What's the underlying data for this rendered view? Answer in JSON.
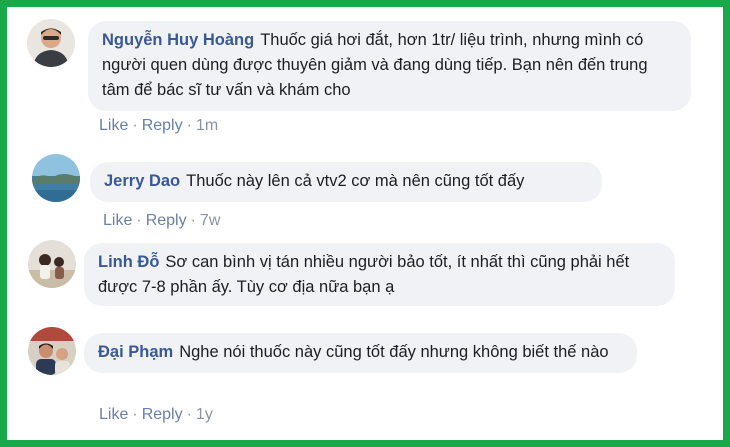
{
  "comments": [
    {
      "author": "Nguyễn Huy Hoàng",
      "text": "Thuốc giá hơi đắt, hơn 1tr/ liệu trình, nhưng mình có người quen dùng được thuyên giảm và đang dùng tiếp. Bạn nên đến trung tâm để bác sĩ tư vấn và khám cho",
      "like": "Like",
      "reply": "Reply",
      "time": "1m"
    },
    {
      "author": "Jerry Dao",
      "text": "Thuốc này lên cả vtv2 cơ mà nên cũng tốt đấy",
      "like": "Like",
      "reply": "Reply",
      "time": "7w"
    },
    {
      "author": "Linh Đỗ",
      "text": "Sơ can bình vị tán nhiều người bảo tốt, ít nhất thì cũng phải hết được 7-8 phần ấy. Tùy cơ địa nữa bạn ạ",
      "like": "",
      "reply": "",
      "time": ""
    },
    {
      "author": "Đại Phạm",
      "text": "Nghe nói thuốc này cũng tốt đấy nhưng không biết thế nào",
      "like": "Like",
      "reply": "Reply",
      "time": "1y"
    }
  ],
  "colors": {
    "frame": "#19a84a",
    "bubble": "#f1f2f5",
    "author": "#385898",
    "action": "#6a7fa8"
  },
  "separator": "·"
}
